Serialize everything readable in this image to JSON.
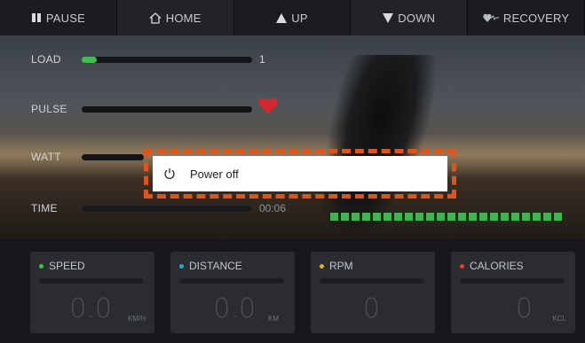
{
  "nav": {
    "pause": "PAUSE",
    "home": "HOME",
    "up": "UP",
    "down": "DOWN",
    "recovery": "RECOVERY"
  },
  "metrics": {
    "load_label": "LOAD",
    "load_value": "1",
    "load_level": 0.09,
    "pulse_label": "PULSE",
    "watt_label": "WATT",
    "time_label": "TIME",
    "time_value": "00:06"
  },
  "popup": {
    "item_label": "Power off",
    "icon": "power-icon"
  },
  "cards": [
    {
      "title": "SPEED",
      "value": "0.0",
      "unit": "KM/H",
      "dot_color": "#3fbf4d"
    },
    {
      "title": "DISTANCE",
      "value": "0.0",
      "unit": "KM",
      "dot_color": "#2aa3c9"
    },
    {
      "title": "RPM",
      "value": "0",
      "unit": "",
      "dot_color": "#e0b020"
    },
    {
      "title": "CALORIES",
      "value": "0",
      "unit": "KCL",
      "dot_color": "#e0402c"
    }
  ],
  "colors": {
    "accent_green": "#3fbf4d",
    "heart_red": "#d8262c",
    "highlight_orange": "#e0541a"
  }
}
